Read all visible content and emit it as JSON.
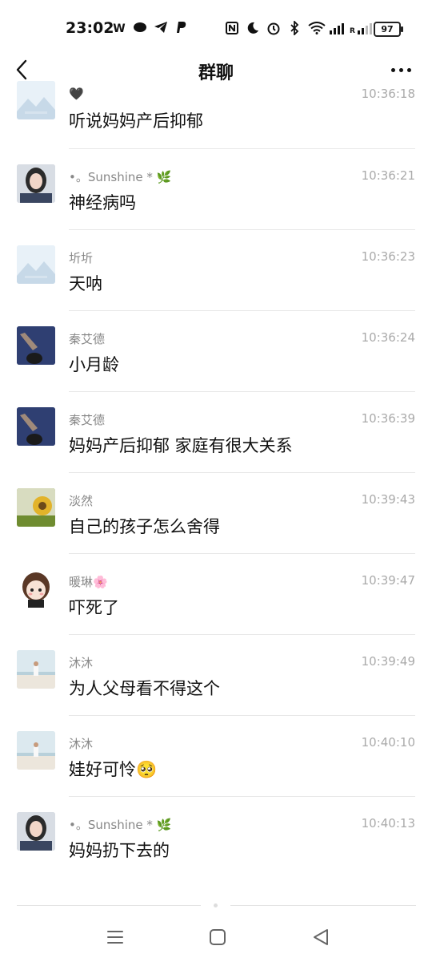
{
  "status_bar": {
    "time": "23:02",
    "left_icons": [
      "W",
      "weibo-icon",
      "telegram-icon",
      "paypal-icon"
    ],
    "right_icons": [
      "nfc-icon",
      "moon-icon",
      "alarm-icon",
      "bluetooth-icon",
      "wifi-icon",
      "signal-icon",
      "roaming-signal-icon"
    ],
    "battery": "97"
  },
  "header": {
    "title": "群聊"
  },
  "messages": [
    {
      "sender": "🖤",
      "time": "10:36:18",
      "text": "听说妈妈产后抑郁",
      "avatar": "mountain"
    },
    {
      "sender": "•。Sunshine * 🌿",
      "time": "10:36:21",
      "text": "神经病吗",
      "avatar": "girl"
    },
    {
      "sender": "圻圻",
      "time": "10:36:23",
      "text": "天呐",
      "avatar": "mountain"
    },
    {
      "sender": "秦艾德",
      "time": "10:36:24",
      "text": "小月龄",
      "avatar": "dark"
    },
    {
      "sender": "秦艾德",
      "time": "10:36:39",
      "text": "妈妈产后抑郁 家庭有很大关系",
      "avatar": "dark"
    },
    {
      "sender": "淡然",
      "time": "10:39:43",
      "text": "自己的孩子怎么舍得",
      "avatar": "sun"
    },
    {
      "sender": "暖琳🌸",
      "time": "10:39:47",
      "text": "吓死了",
      "avatar": "cartoon"
    },
    {
      "sender": "沐沐",
      "time": "10:39:49",
      "text": "为人父母看不得这个",
      "avatar": "beach"
    },
    {
      "sender": "沐沐",
      "time": "10:40:10",
      "text": "娃好可怜🥺",
      "avatar": "beach"
    },
    {
      "sender": "•。Sunshine * 🌿",
      "time": "10:40:13",
      "text": "妈妈扔下去的",
      "avatar": "girl"
    }
  ]
}
